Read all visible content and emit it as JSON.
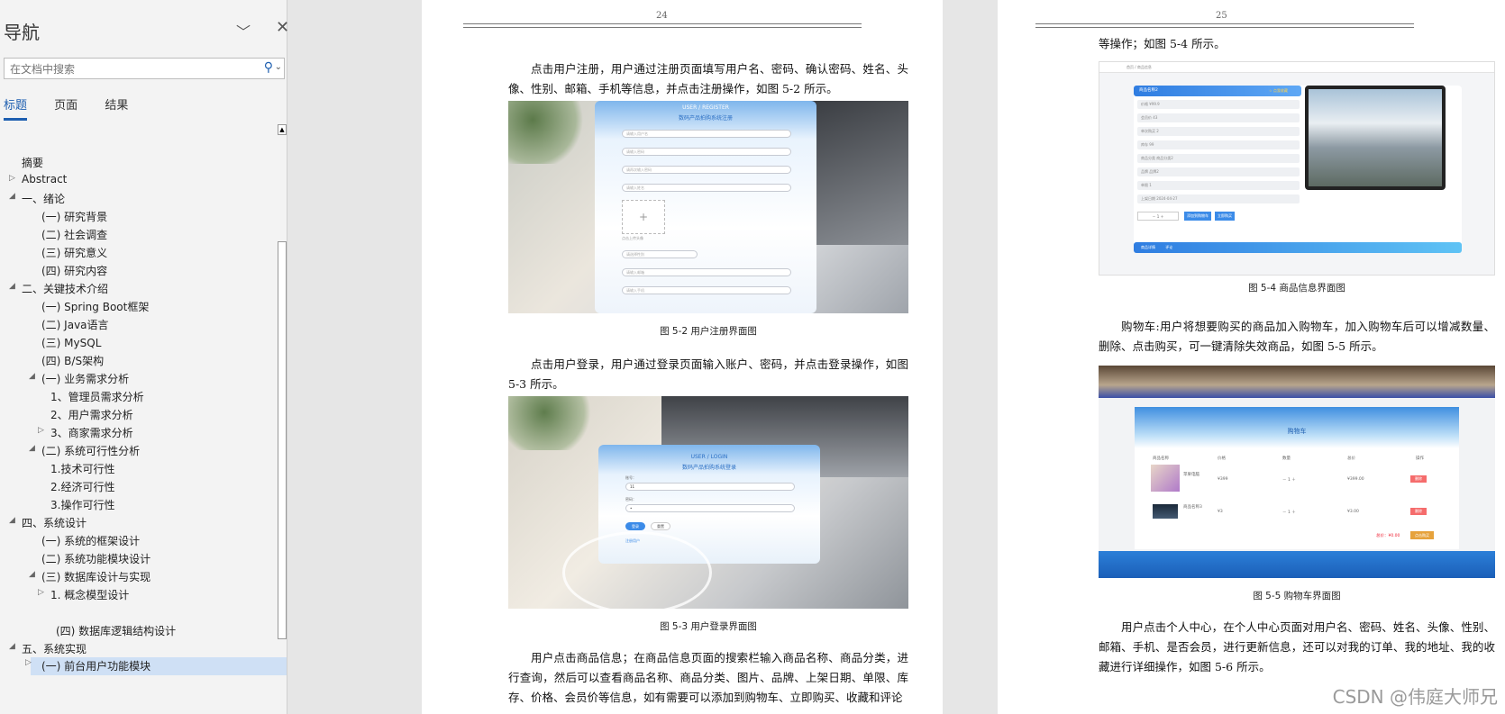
{
  "nav": {
    "title": "导航",
    "search_placeholder": "在文档中搜索",
    "tabs": [
      "标题",
      "页面",
      "结果"
    ],
    "items": [
      {
        "label": "摘要"
      },
      {
        "label": "Abstract"
      },
      {
        "label": "一、绪论"
      },
      {
        "label": "(一) 研究背景"
      },
      {
        "label": "(二) 社会调查"
      },
      {
        "label": "(三) 研究意义"
      },
      {
        "label": "(四) 研究内容"
      },
      {
        "label": "二、关键技术介绍"
      },
      {
        "label": "(一)  Spring Boot框架"
      },
      {
        "label": "(二) Java语言"
      },
      {
        "label": "(三) MySQL"
      },
      {
        "label": "(四) B/S架构"
      },
      {
        "label": "(一) 业务需求分析"
      },
      {
        "label": "1、管理员需求分析"
      },
      {
        "label": "2、用户需求分析"
      },
      {
        "label": "3、商家需求分析"
      },
      {
        "label": "(二) 系统可行性分析"
      },
      {
        "label": "1.技术可行性"
      },
      {
        "label": "2.经济可行性"
      },
      {
        "label": "3.操作可行性"
      },
      {
        "label": "四、系统设计"
      },
      {
        "label": "(一) 系统的框架设计"
      },
      {
        "label": "(二) 系统功能模块设计"
      },
      {
        "label": "(三)  数据库设计与实现"
      },
      {
        "label": "1. 概念模型设计"
      },
      {
        "label": "(四) 数据库逻辑结构设计"
      },
      {
        "label": "五、系统实现"
      },
      {
        "label": "(一) 前台用户功能模块"
      }
    ]
  },
  "page24": {
    "number": "24",
    "para1": "点击用户注册，用户通过注册页面填写用户名、密码、确认密码、姓名、头像、性别、邮箱、手机等信息，并点击注册操作，如图 5-2 所示。",
    "caption1": "图 5-2 用户注册界面图",
    "para2": "点击用户登录，用户通过登录页面输入账户、密码，并点击登录操作，如图 5-3 所示。",
    "caption2": "图 5-3 用户登录界面图",
    "para3": "用户点击商品信息；在商品信息页面的搜索栏输入商品名称、商品分类，进行查询，然后可以查看商品名称、商品分类、图片、品牌、上架日期、单限、库存、价格、会员价等信息，如有需要可以添加到购物车、立即购买、收藏和评论"
  },
  "page25": {
    "number": "25",
    "para0": "等操作；如图 5-4 所示。",
    "caption1": "图 5-4 商品信息界面图",
    "para1": "购物车:用户将想要购买的商品加入购物车，加入购物车后可以增减数量、删除、点击购买，可一键清除失效商品，如图 5-5 所示。",
    "caption2": "图 5-5 购物车界面图",
    "para2": "用户点击个人中心，在个人中心页面对用户名、密码、姓名、头像、性别、邮箱、手机、是否会员，进行更新信息，还可以对我的订单、我的地址、我的收藏进行详细操作，如图 5-6 所示。"
  },
  "screens": {
    "register_title_en": "USER / REGISTER",
    "register_title": "数码产品拍购系统注册",
    "register_fields": [
      "请输入用户名",
      "请输入密码",
      "请再次输入密码",
      "请输入姓名"
    ],
    "register_upload": "点击上传头像",
    "register_fields2": [
      "请选择性别",
      "请输入邮箱",
      "请输入手机"
    ],
    "login_title_en": "USER / LOGIN",
    "login_title": "数码产品拍购系统登录",
    "login_account_label": "账号：",
    "login_account_value": "11",
    "login_password_label": "密码：",
    "login_password_value": "•",
    "login_btn": "登录",
    "login_reset": "重置",
    "login_register_link": "注册用户",
    "product_breadcrumb": "首页 / 商品信息",
    "product_name": "商品名称2",
    "product_fav": "☆ 点我收藏",
    "product_fields": [
      "价格  ¥99.9",
      "会员价  43",
      "单次购买  2",
      "库存  99",
      "商品分类  商品分类2",
      "品牌  品牌2",
      "单限  1",
      "上架日期  2024-04-27"
    ],
    "product_add_cart": "添加到购物车",
    "product_buy": "立即购买",
    "product_tabs": [
      "商品详情",
      "评论"
    ],
    "cart_title": "购物车",
    "cart_headers": [
      "商品名称",
      "价格",
      "数量",
      "总价",
      "操作"
    ],
    "cart_rows": [
      {
        "name": "苹果电脑",
        "price": "¥399",
        "qty": "1",
        "total": "¥399.00",
        "op": "删除"
      },
      {
        "name": "商品名称3",
        "price": "¥3",
        "qty": "1",
        "total": "¥3.00",
        "op": "删除"
      }
    ],
    "cart_total": "总价：¥0.00",
    "cart_buy": "点击购买"
  },
  "watermark": "CSDN @伟庭大师兄"
}
